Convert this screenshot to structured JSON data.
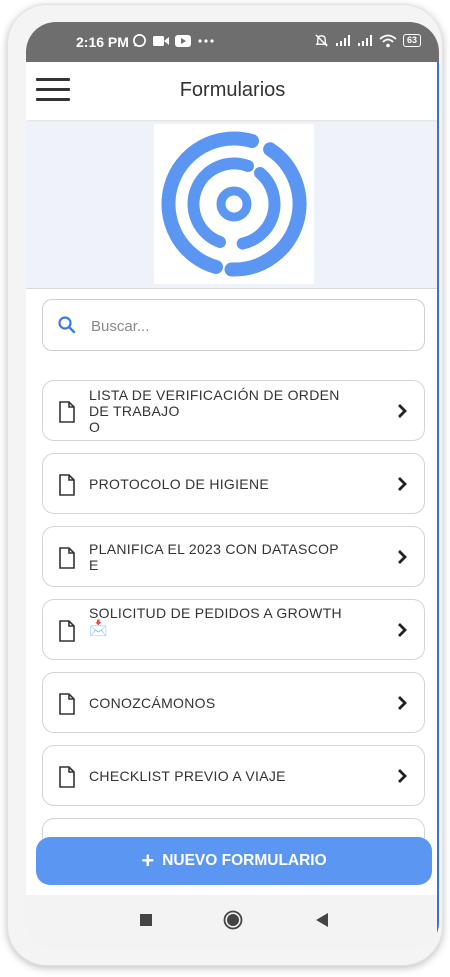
{
  "status_bar": {
    "time": "2:16 PM",
    "left_icons": [
      "whatsapp-icon",
      "video-icon",
      "youtube-icon",
      "more-dots-icon"
    ],
    "right_icons": [
      "mute-icon",
      "signal-icon",
      "signal-icon",
      "wifi-icon"
    ],
    "battery": "63"
  },
  "app_bar": {
    "title": "Formularios",
    "menu_icon": "hamburger-icon"
  },
  "brand": {
    "logo": "concentric-circles-logo",
    "color": "#5b97f2"
  },
  "search": {
    "placeholder": "Buscar...",
    "value": ""
  },
  "forms": [
    {
      "line1": "LISTA DE VERIFICACIÓN DE ORDEN",
      "line2": "DE TRABAJO",
      "line3": "O"
    },
    {
      "line1": "PROTOCOLO DE HIGIENE"
    },
    {
      "line1": "PLANIFICA EL 2023 CON DATASCOP",
      "line2": "E"
    },
    {
      "line1": "SOLICITUD DE PEDIDOS A GROWTH",
      "line2": "📩"
    },
    {
      "line1": "CONOZCÁMONOS"
    },
    {
      "line1": "CHECKLIST PREVIO A VIAJE"
    }
  ],
  "new_form_button": {
    "icon": "plus-icon",
    "label": "NUEVO FORMULARIO"
  },
  "nav_bar": {
    "buttons": [
      "recents-square-icon",
      "home-circle-icon",
      "back-triangle-icon"
    ]
  }
}
